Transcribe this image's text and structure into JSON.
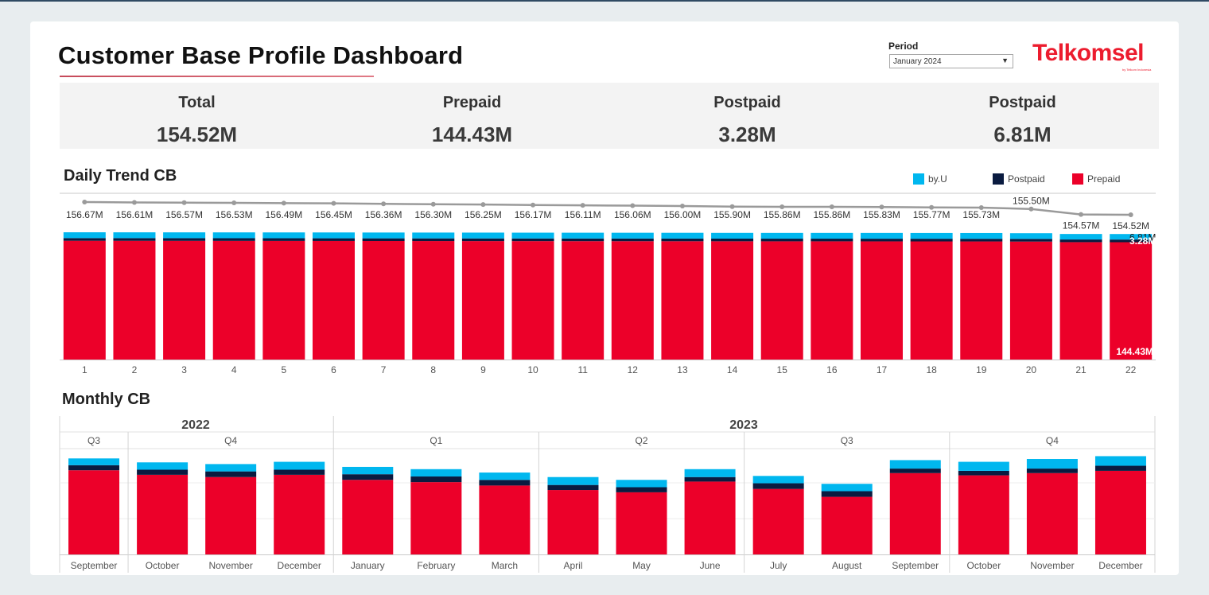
{
  "header": {
    "title": "Customer Base Profile Dashboard",
    "period_label": "Period",
    "period_value": "January 2024",
    "logo_text": "Telkomsel",
    "logo_sub": "by Telkom Indonesia"
  },
  "kpis": [
    {
      "label": "Total",
      "value": "154.52M"
    },
    {
      "label": "Prepaid",
      "value": "144.43M"
    },
    {
      "label": "Postpaid",
      "value": "3.28M"
    },
    {
      "label": "Postpaid",
      "value": "6.81M"
    }
  ],
  "daily": {
    "title": "Daily Trend CB",
    "legend": [
      {
        "name": "by.U",
        "color": "#00b7ef"
      },
      {
        "name": "Postpaid",
        "color": "#0a1b40"
      },
      {
        "name": "Prepaid",
        "color": "#ec0029"
      }
    ]
  },
  "monthly": {
    "title": "Monthly CB"
  },
  "colors": {
    "byu": "#00b7ef",
    "postpaid": "#0a1b40",
    "prepaid": "#ec0029",
    "line": "#9a9a9a"
  },
  "chart_data": [
    {
      "type": "bar",
      "title": "Daily Trend CB",
      "stacked": true,
      "categories": [
        "1",
        "2",
        "3",
        "4",
        "5",
        "6",
        "7",
        "8",
        "9",
        "10",
        "11",
        "12",
        "13",
        "14",
        "15",
        "16",
        "17",
        "18",
        "19",
        "20",
        "21",
        "22"
      ],
      "total_labels": [
        "156.67M",
        "156.61M",
        "156.57M",
        "156.53M",
        "156.49M",
        "156.45M",
        "156.36M",
        "156.30M",
        "156.25M",
        "156.17M",
        "156.11M",
        "156.06M",
        "156.00M",
        "155.90M",
        "155.86M",
        "155.86M",
        "155.83M",
        "155.77M",
        "155.73M",
        "155.50M",
        "154.57M",
        "154.52M"
      ],
      "series": [
        {
          "name": "Prepaid",
          "values": [
            146.2,
            146.15,
            146.1,
            146.05,
            146.0,
            145.95,
            145.9,
            145.85,
            145.8,
            145.75,
            145.7,
            145.65,
            145.6,
            145.55,
            145.5,
            145.5,
            145.45,
            145.4,
            145.35,
            145.2,
            144.5,
            144.43
          ]
        },
        {
          "name": "Postpaid",
          "values": [
            3.3,
            3.3,
            3.3,
            3.3,
            3.3,
            3.3,
            3.3,
            3.3,
            3.3,
            3.3,
            3.3,
            3.3,
            3.3,
            3.3,
            3.3,
            3.3,
            3.3,
            3.3,
            3.3,
            3.3,
            3.28,
            3.28
          ]
        },
        {
          "name": "by.U",
          "values": [
            7.17,
            7.16,
            7.17,
            7.18,
            7.19,
            7.2,
            7.16,
            7.15,
            7.15,
            7.12,
            7.11,
            7.11,
            7.1,
            7.05,
            7.06,
            7.06,
            7.08,
            7.07,
            7.08,
            7.0,
            6.79,
            6.81
          ]
        }
      ],
      "total_line": [
        156.67,
        156.61,
        156.57,
        156.53,
        156.49,
        156.45,
        156.36,
        156.3,
        156.25,
        156.17,
        156.11,
        156.06,
        156.0,
        155.9,
        155.86,
        155.86,
        155.83,
        155.77,
        155.73,
        155.5,
        154.57,
        154.52
      ],
      "last_labels": {
        "byu": "6.81M",
        "postpaid": "3.28M",
        "prepaid": "144.43M"
      }
    },
    {
      "type": "bar",
      "title": "Monthly CB",
      "stacked": true,
      "groups": [
        {
          "year": "2022",
          "quarters": [
            {
              "q": "Q3",
              "months": [
                "September"
              ]
            },
            {
              "q": "Q4",
              "months": [
                "October",
                "November",
                "December"
              ]
            }
          ]
        },
        {
          "year": "2023",
          "quarters": [
            {
              "q": "Q1",
              "months": [
                "January",
                "February",
                "March"
              ]
            },
            {
              "q": "Q2",
              "months": [
                "April",
                "May",
                "June"
              ]
            },
            {
              "q": "Q3",
              "months": [
                "July",
                "August",
                "September"
              ]
            },
            {
              "q": "Q4",
              "months": [
                "October",
                "November",
                "December"
              ]
            }
          ]
        }
      ],
      "categories": [
        "September",
        "October",
        "November",
        "December",
        "January",
        "February",
        "March",
        "April",
        "May",
        "June",
        "July",
        "August",
        "September",
        "October",
        "November",
        "December"
      ],
      "series": [
        {
          "name": "Prepaid",
          "values": [
            149,
            141,
            137,
            141,
            132,
            128,
            122,
            114,
            110,
            129,
            116,
            102,
            144,
            140,
            144,
            148
          ]
        },
        {
          "name": "Postpaid",
          "values": [
            9,
            9,
            10,
            9,
            10,
            10,
            10,
            9,
            9,
            8,
            10,
            10,
            8,
            8,
            8,
            9
          ]
        },
        {
          "name": "by.U",
          "values": [
            12,
            13,
            13,
            14,
            13,
            13,
            13,
            14,
            13,
            14,
            13,
            13,
            15,
            16,
            17,
            17
          ]
        }
      ]
    }
  ]
}
